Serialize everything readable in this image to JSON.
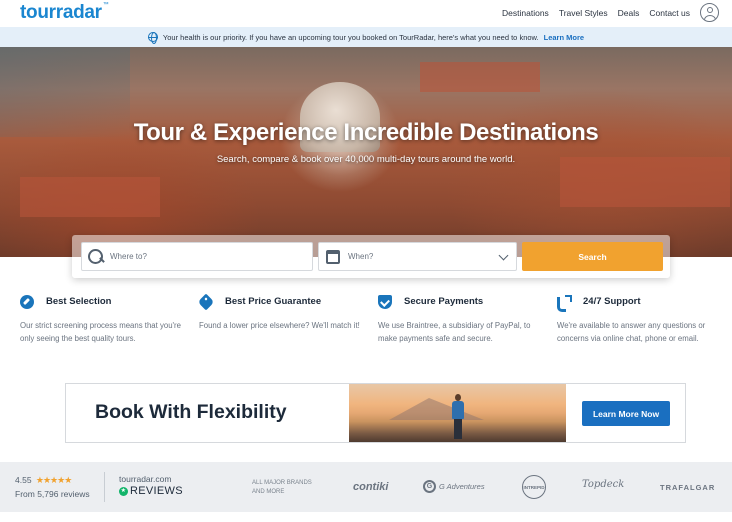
{
  "header": {
    "logo": "tourradar",
    "logo_tm": "™",
    "nav": [
      "Destinations",
      "Travel Styles",
      "Deals",
      "Contact us"
    ]
  },
  "notice": {
    "text": "Your health is our priority. If you have an upcoming tour you booked on TourRadar, here's what you need to know.",
    "link": "Learn More"
  },
  "hero": {
    "title": "Tour & Experience Incredible Destinations",
    "subtitle": "Search, compare & book over 40,000 multi-day tours around the world."
  },
  "search": {
    "where_placeholder": "Where to?",
    "when_placeholder": "When?",
    "button": "Search"
  },
  "features": [
    {
      "title": "Best Selection",
      "desc": "Our strict screening process means that you're only seeing the best quality tours.",
      "icon": "compass-icon"
    },
    {
      "title": "Best Price Guarantee",
      "desc": "Found a lower price elsewhere? We'll match it!",
      "icon": "price-tag-icon"
    },
    {
      "title": "Secure Payments",
      "desc": "We use Braintree, a subsidiary of PayPal, to make payments safe and secure.",
      "icon": "shield-check-icon"
    },
    {
      "title": "24/7 Support",
      "desc": "We're available to answer any questions or concerns via online chat, phone or email.",
      "icon": "phone-icon"
    }
  ],
  "banner": {
    "title": "Book With Flexibility",
    "button": "Learn More Now"
  },
  "footer": {
    "rating_value": "4.55",
    "stars": "★★★★★",
    "rating_sub": "From 5,796 reviews",
    "reviews_site": "tourradar.com",
    "reviews_label": "REVIEWS",
    "brands_label_1": "ALL MAJOR BRANDS",
    "brands_label_2": "AND MORE",
    "brands": {
      "contiki": "contiki",
      "g_letter": "G",
      "gadventures": "G Adventures",
      "intrepid": "INTREPID",
      "topdeck": "Topdeck",
      "trafalgar": "TRAFALGAR"
    }
  },
  "colors": {
    "brand_blue": "#1a86d0",
    "search_orange": "#f1a22f",
    "cta_blue": "#1a6fc0",
    "reviews_green": "#12b46a"
  }
}
